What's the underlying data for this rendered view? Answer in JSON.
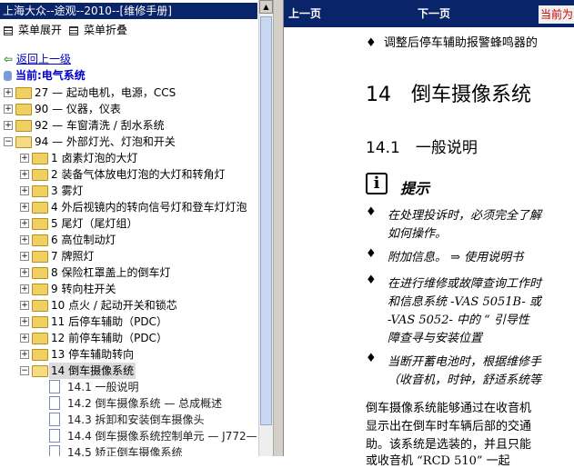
{
  "left_pane": {
    "title": "上海大众--途观--2010--[维修手册]",
    "expand_menu": "菜单展开",
    "collapse_menu": "菜单折叠",
    "back_link": "返回上一级",
    "current": "当前:电气系统",
    "tree": [
      {
        "label": "27 — 起动电机，电源，CCS"
      },
      {
        "label": "90 — 仪器，仪表"
      },
      {
        "label": "92 — 车窗清洗 / 刮水系统"
      },
      {
        "label": "94 — 外部灯光、灯泡和开关"
      },
      {
        "label": "1 卤素灯泡的大灯"
      },
      {
        "label": "2 装备气体放电灯泡的大灯和转角灯"
      },
      {
        "label": "3 雾灯"
      },
      {
        "label": "4 外后视镜内的转向信号灯和登车灯灯泡"
      },
      {
        "label": "5 尾灯（尾灯组）"
      },
      {
        "label": "6 高位制动灯"
      },
      {
        "label": "7 牌照灯"
      },
      {
        "label": "8 保险杠罩盖上的倒车灯"
      },
      {
        "label": "9 转向柱开关"
      },
      {
        "label": "10 点火 / 起动开关和锁芯"
      },
      {
        "label": "11 后停车辅助（PDC）"
      },
      {
        "label": "12 前停车辅助（PDC）"
      },
      {
        "label": "13 停车辅助转向"
      },
      {
        "label": "14 倒车摄像系统"
      },
      {
        "label": "14.1 一般说明"
      },
      {
        "label": "14.2 倒车摄像系统 — 总成概述"
      },
      {
        "label": "14.3 拆卸和安装倒车摄像头"
      },
      {
        "label": "14.4 倒车摄像系统控制单元 — J772—"
      },
      {
        "label": "14.5 矫正倒车摄像系统"
      }
    ]
  },
  "right_pane": {
    "prev_page": "上一页",
    "next_page": "下一页",
    "note": "当前为",
    "bullet_top": "调整后停车辅助报警蜂鸣器的",
    "chapter": "14　倒车摄像系统",
    "section": "14.1　一般说明",
    "tip_icon": "i",
    "tip_label": "提示",
    "tips": [
      [
        "在处理投诉时，必须完全了解",
        "如何操作。"
      ],
      [
        "附加信息。 ⇒ 使用说明书"
      ],
      [
        "在进行维修或故障查询工作时",
        "和信息系统 -VAS 5051B- 或",
        "-VAS 5052- 中的 “ 引导性",
        "障查寻与安装位置"
      ],
      [
        "当断开蓄电池时，根据维修手",
        "（收音机，时钟，舒适系统等"
      ]
    ],
    "body_text": [
      "倒车摄像系统能够通过在收音机",
      "显示出在倒车时车辆后部的交通",
      "助。该系统是选装的，并且只能",
      "或收音机 “RCD 510” 一起"
    ]
  }
}
